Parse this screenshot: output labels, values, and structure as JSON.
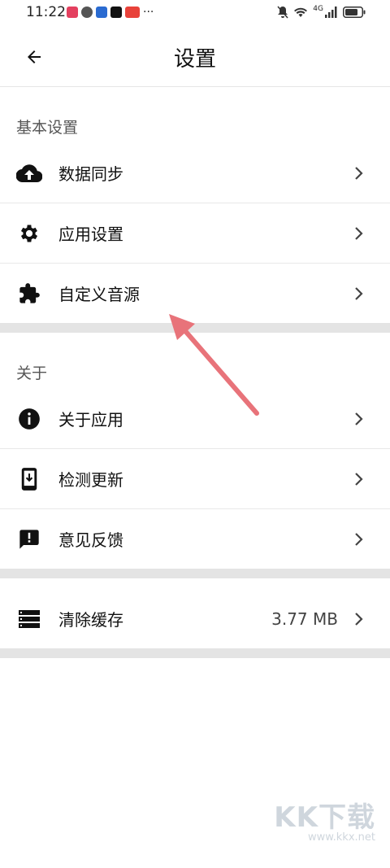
{
  "status": {
    "time": "11:22",
    "network": "4G"
  },
  "header": {
    "title": "设置"
  },
  "sections": {
    "basic": {
      "title": "基本设置",
      "items": [
        {
          "label": "数据同步",
          "icon": "cloud-upload-icon"
        },
        {
          "label": "应用设置",
          "icon": "gear-icon"
        },
        {
          "label": "自定义音源",
          "icon": "puzzle-icon"
        }
      ]
    },
    "about": {
      "title": "关于",
      "items": [
        {
          "label": "关于应用",
          "icon": "info-icon"
        },
        {
          "label": "检测更新",
          "icon": "phone-download-icon"
        },
        {
          "label": "意见反馈",
          "icon": "feedback-icon"
        }
      ]
    },
    "cache": {
      "items": [
        {
          "label": "清除缓存",
          "value": "3.77 MB",
          "icon": "storage-icon"
        }
      ]
    }
  },
  "watermark": {
    "logo": "KK下载",
    "url": "www.kkx.net"
  },
  "colors": {
    "accent_arrow": "#e8737a",
    "gap": "#e4e4e4"
  }
}
